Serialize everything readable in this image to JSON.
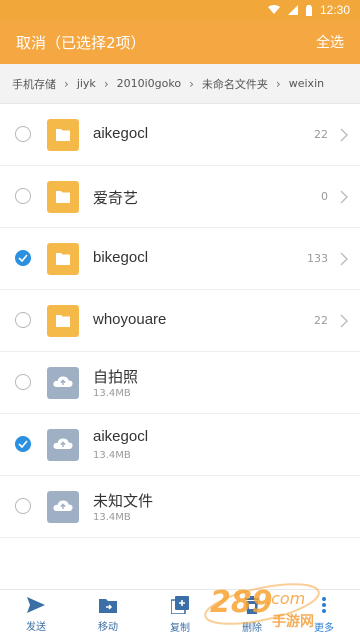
{
  "status_bar": {
    "time": "12:30",
    "icons": [
      "wifi-icon",
      "signal-icon",
      "battery-icon"
    ]
  },
  "app_bar": {
    "cancel_label": "取消（已选择2项）",
    "select_all_label": "全选",
    "background_color": "#f5a742"
  },
  "breadcrumb": {
    "items": [
      "手机存储",
      "jiyk",
      "2010i0goko",
      "未命名文件夹",
      "weixin"
    ]
  },
  "files": [
    {
      "name": "aikegocl",
      "type": "folder",
      "count": "22",
      "size": "",
      "checked": false
    },
    {
      "name": "爱奇艺",
      "type": "folder",
      "count": "0",
      "size": "",
      "checked": false
    },
    {
      "name": "bikegocl",
      "type": "folder",
      "count": "133",
      "size": "",
      "checked": true
    },
    {
      "name": "whoyouare",
      "type": "folder",
      "count": "22",
      "size": "",
      "checked": false
    },
    {
      "name": "自拍照",
      "type": "cloud",
      "count": "",
      "size": "13.4MB",
      "checked": false
    },
    {
      "name": "aikegocl",
      "type": "cloud",
      "count": "",
      "size": "13.4MB",
      "checked": true
    },
    {
      "name": "未知文件",
      "type": "cloud",
      "count": "",
      "size": "13.4MB",
      "checked": false
    }
  ],
  "bottom_bar": {
    "items": [
      {
        "label": "发送",
        "icon": "send-icon"
      },
      {
        "label": "移动",
        "icon": "move-folder-icon"
      },
      {
        "label": "复制",
        "icon": "copy-icon"
      },
      {
        "label": "删除",
        "icon": "trash-icon"
      },
      {
        "label": "更多",
        "icon": "more-icon"
      }
    ]
  },
  "watermark": {
    "brand": "289",
    "suffix": ".com",
    "subtitle": "手游网"
  },
  "colors": {
    "accent": "#f5a742",
    "check": "#2b90e0",
    "folder": "#f5b94a",
    "cloud": "#9fb0c4"
  }
}
